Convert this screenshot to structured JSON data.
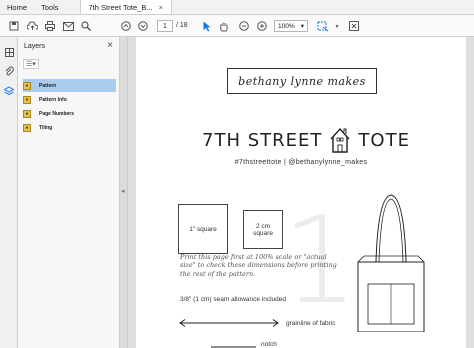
{
  "menubar": {
    "home": "Home",
    "tools": "Tools",
    "doc_tab": "7th Street Tote_B...",
    "doc_tab_close": "×"
  },
  "toolbar": {
    "page_current": "1",
    "page_total": "/ 18",
    "zoom": "100%",
    "icons": [
      "save-icon",
      "upload-icon",
      "print-icon",
      "mail-icon",
      "search-icon",
      "page-up-icon",
      "page-down-icon",
      "select-arrow-icon",
      "hand-icon",
      "zoom-out-icon",
      "zoom-in-icon",
      "marquee-icon",
      "fit-page-icon"
    ]
  },
  "panel": {
    "title": "Layers",
    "close": "×",
    "options": "☰▾",
    "layers": [
      {
        "label": "Pattern",
        "selected": true
      },
      {
        "label": "Pattern Info",
        "selected": false
      },
      {
        "label": "Page Numbers",
        "selected": false
      },
      {
        "label": "Tiling",
        "selected": false
      }
    ]
  },
  "document": {
    "logo_text": "bethany lynne makes",
    "title_left": "7TH STREET",
    "title_right": "TOTE",
    "hashtags": "#7thstreettote  |  @bethanylynne_makes",
    "big_number": "1",
    "square1": "1\" square",
    "square2": "2 cm square",
    "instructions": "Print this page first at 100% scale or \"actual size\" to check these dimensions before printing the rest of the pattern.",
    "seam": "3/8\" (1 cm) seam allowance included",
    "grain": "grainline of fabric",
    "notch": "notch"
  },
  "colors": {
    "accent": "#1473e6",
    "selected_layer": "#a9cdee",
    "layer_icon": "#e7c24a"
  }
}
